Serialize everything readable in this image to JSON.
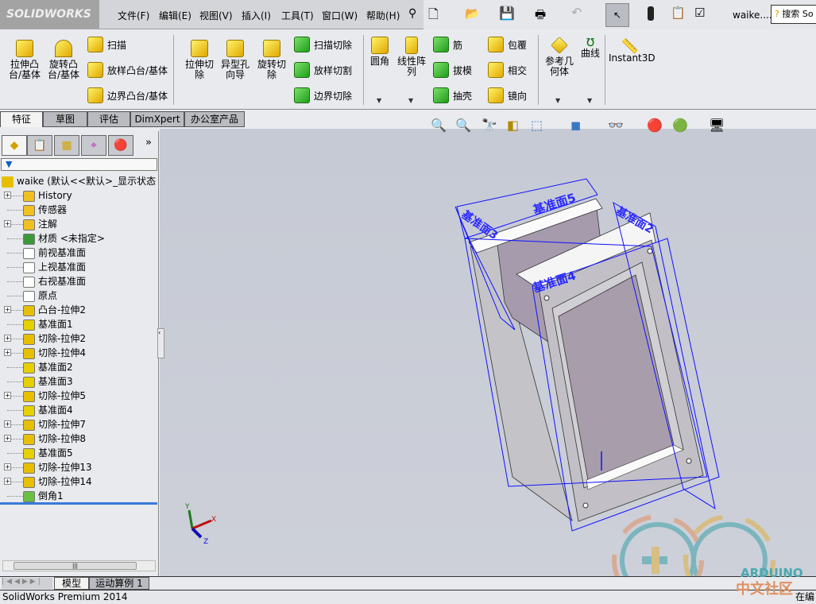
{
  "app": {
    "logo": "SOLIDWORKS",
    "doc_name": "waike....",
    "search_placeholder": "搜索 So"
  },
  "menu": [
    "文件(F)",
    "编辑(E)",
    "视图(V)",
    "插入(I)",
    "工具(T)",
    "窗口(W)",
    "帮助(H)"
  ],
  "ribbon": {
    "extrude_boss": "拉伸凸台/基体",
    "revolve_boss": "旋转凸台/基体",
    "sweep": "扫描",
    "loft": "放样凸台/基体",
    "boundary": "边界凸台/基体",
    "extrude_cut": "拉伸切除",
    "hole_wizard": "异型孔向导",
    "revolve_cut": "旋转切除",
    "swept_cut": "扫描切除",
    "lofted_cut": "放样切割",
    "boundary_cut": "边界切除",
    "fillet": "圆角",
    "linear_pattern": "线性阵列",
    "rib": "筋",
    "draft": "拔模",
    "shell": "抽壳",
    "wrap": "包覆",
    "intersect": "相交",
    "mirror": "镜向",
    "ref_geometry": "参考几何体",
    "curves": "曲线",
    "instant3d": "Instant3D"
  },
  "tabs": [
    "特征",
    "草图",
    "评估",
    "DimXpert",
    "办公室产品"
  ],
  "tree": {
    "root": "waike  (默认<<默认>_显示状态",
    "items": [
      {
        "label": "History",
        "expand": true
      },
      {
        "label": "传感器"
      },
      {
        "label": "注解",
        "expand": true
      },
      {
        "label": "材质 <未指定>"
      },
      {
        "label": "前视基准面"
      },
      {
        "label": "上视基准面"
      },
      {
        "label": "右视基准面"
      },
      {
        "label": "原点"
      },
      {
        "label": "凸台-拉伸2",
        "expand": true
      },
      {
        "label": "基准面1"
      },
      {
        "label": "切除-拉伸2",
        "expand": true
      },
      {
        "label": "切除-拉伸4",
        "expand": true
      },
      {
        "label": "基准面2"
      },
      {
        "label": "基准面3"
      },
      {
        "label": "切除-拉伸5",
        "expand": true
      },
      {
        "label": "基准面4"
      },
      {
        "label": "切除-拉伸7",
        "expand": true
      },
      {
        "label": "切除-拉伸8",
        "expand": true
      },
      {
        "label": "基准面5"
      },
      {
        "label": "切除-拉伸13",
        "expand": true
      },
      {
        "label": "切除-拉伸14",
        "expand": true
      },
      {
        "label": "倒角1"
      }
    ]
  },
  "viewport": {
    "planes": [
      "基准面5",
      "基准面3",
      "基准面2",
      "基准面4"
    ],
    "axes": {
      "x": "X",
      "y": "Y",
      "z": "Z"
    }
  },
  "bottom_tabs": [
    "模型",
    "运动算例 1"
  ],
  "status": {
    "text": "SolidWorks Premium 2014",
    "right": "在编"
  },
  "watermark": {
    "line1": "ARDUINO",
    "line2": "中文社区"
  }
}
